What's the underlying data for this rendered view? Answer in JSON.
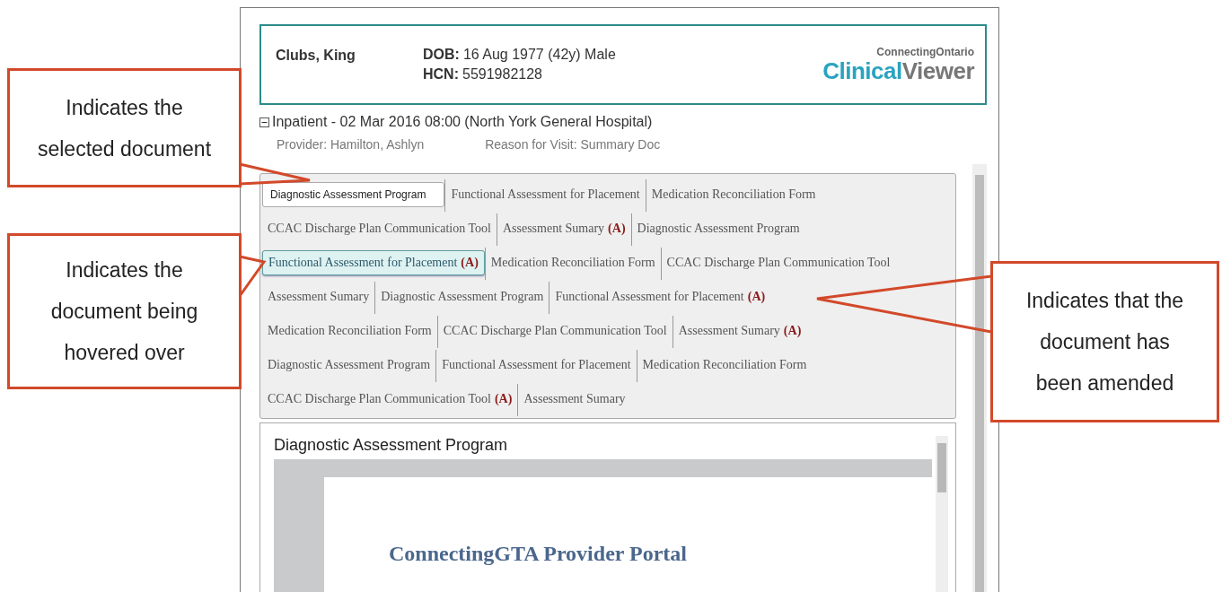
{
  "patient": {
    "name": "Clubs, King",
    "dob_label": "DOB:",
    "dob": "16 Aug 1977 (42y) Male",
    "hcn_label": "HCN:",
    "hcn": "5591982128"
  },
  "logo": {
    "brand": "ConnectingOntario",
    "product_part_1": "Clinical",
    "product_part_2": "Viewer"
  },
  "encounter": {
    "expanded": true,
    "title": "Inpatient - 02 Mar 2016 08:00 (North York General Hospital)",
    "provider": "Provider: Hamilton, Ashlyn",
    "reason": "Reason for Visit: Summary Doc"
  },
  "document_tabs": [
    [
      {
        "label": "Diagnostic Assessment Program",
        "selected": true,
        "hovered": false
      },
      {
        "label": "Functional Assessment for Placement",
        "selected": false,
        "hovered": false
      },
      {
        "label": "Medication Reconciliation Form",
        "selected": false,
        "hovered": false
      }
    ],
    [
      {
        "label": "CCAC Discharge Plan Communication Tool",
        "selected": false,
        "hovered": false
      },
      {
        "label": "Assessment Sumary",
        "badge": "(A)",
        "selected": false,
        "hovered": false
      },
      {
        "label": "Diagnostic Assessment Program",
        "selected": false,
        "hovered": false
      }
    ],
    [
      {
        "label": "Functional Assessment for Placement",
        "badge": "(A)",
        "selected": false,
        "hovered": true
      },
      {
        "label": "Medication Reconciliation Form",
        "selected": false,
        "hovered": false
      },
      {
        "label": "CCAC Discharge Plan Communication Tool",
        "selected": false,
        "hovered": false
      }
    ],
    [
      {
        "label": "Assessment Sumary",
        "selected": false,
        "hovered": false
      },
      {
        "label": "Diagnostic Assessment Program",
        "selected": false,
        "hovered": false
      },
      {
        "label": "Functional Assessment for Placement",
        "badge": "(A)",
        "selected": false,
        "hovered": false
      }
    ],
    [
      {
        "label": "Medication Reconciliation Form",
        "selected": false,
        "hovered": false
      },
      {
        "label": "CCAC Discharge Plan Communication Tool",
        "selected": false,
        "hovered": false
      },
      {
        "label": "Assessment Sumary",
        "badge": "(A)",
        "selected": false,
        "hovered": false
      }
    ],
    [
      {
        "label": "Diagnostic Assessment Program",
        "selected": false,
        "hovered": false
      },
      {
        "label": "Functional Assessment for Placement",
        "selected": false,
        "hovered": false
      },
      {
        "label": "Medication Reconciliation Form",
        "selected": false,
        "hovered": false
      }
    ],
    [
      {
        "label": "CCAC Discharge Plan Communication Tool",
        "badge": "(A)",
        "selected": false,
        "hovered": false
      },
      {
        "label": "Assessment Sumary",
        "selected": false,
        "hovered": false
      }
    ]
  ],
  "document": {
    "title": "Diagnostic Assessment Program",
    "heading": "ConnectingGTA Provider Portal"
  },
  "callouts": [
    {
      "text": "Indicates the selected document"
    },
    {
      "text": "Indicates the document being hovered over"
    },
    {
      "text": "Indicates that the document has been amended"
    }
  ]
}
